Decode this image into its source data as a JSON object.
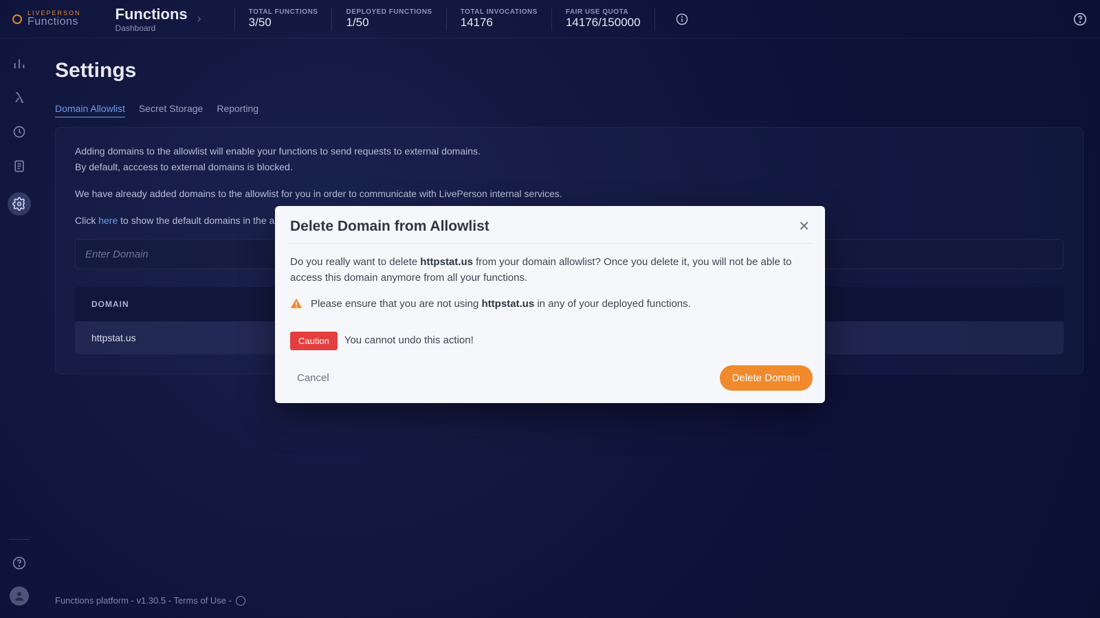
{
  "logo": {
    "brand_top": "LIVEPERSON",
    "brand_bottom": "Functions"
  },
  "breadcrumb": {
    "title": "Functions",
    "subtitle": "Dashboard"
  },
  "stats": {
    "total_functions": {
      "label": "TOTAL FUNCTIONS",
      "value": "3/50"
    },
    "deployed_functions": {
      "label": "DEPLOYED FUNCTIONS",
      "value": "1/50"
    },
    "total_invocations": {
      "label": "TOTAL INVOCATIONS",
      "value": "14176"
    },
    "fair_use_quota": {
      "label": "FAIR USE QUOTA",
      "value": "14176/150000"
    }
  },
  "page": {
    "title": "Settings"
  },
  "tabs": {
    "allowlist": "Domain Allowlist",
    "secrets": "Secret Storage",
    "reporting": "Reporting"
  },
  "allowlist": {
    "desc1": "Adding domains to the allowlist will enable your functions to send requests to external domains.",
    "desc2": "By default, acccess to external domains is blocked.",
    "desc3a": "We have already added domains to the allowlist for you in order to communicate with LivePerson internal services.",
    "desc4_prefix": "Click ",
    "desc4_link": "here",
    "desc4_suffix": " to show the default domains in the allowlist.",
    "input_placeholder": "Enter Domain",
    "column_header": "DOMAIN",
    "rows": [
      "httpstat.us"
    ]
  },
  "modal": {
    "title": "Delete Domain from Allowlist",
    "q_prefix": "Do you really want to delete ",
    "domain": "httpstat.us",
    "q_suffix": " from your domain allowlist? Once you delete it, you will not be able to access this domain anymore from all your functions.",
    "warn_prefix": "Please ensure that you are not using ",
    "warn_suffix": " in any of your deployed functions.",
    "caution_badge": "Caution",
    "caution_text": "You cannot undo this action!",
    "cancel": "Cancel",
    "delete": "Delete Domain"
  },
  "footer": {
    "text": "Functions platform - v1.30.5 - Terms of Use - "
  }
}
